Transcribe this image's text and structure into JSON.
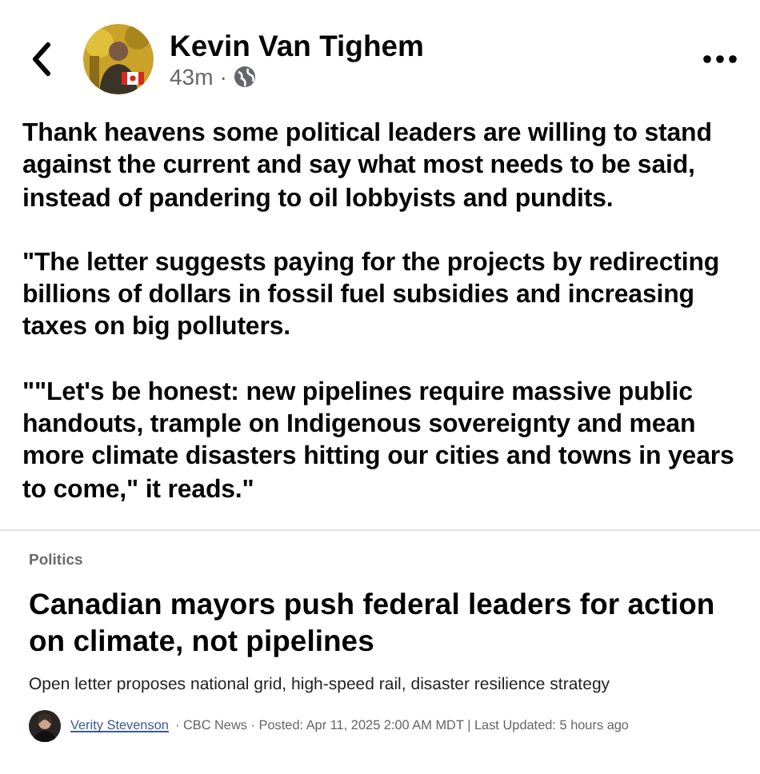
{
  "post": {
    "author": "Kevin Van Tighem",
    "time": "43m",
    "separator": "·",
    "paragraphs": [
      "Thank heavens some political leaders are willing to stand against the current and say what most needs to be said, instead of pandering to oil lobbyists and pundits.",
      "\"The letter suggests paying for the projects by redirecting billions of dollars in fossil fuel subsidies and increasing taxes on big polluters.",
      "\"\"Let's be honest: new pipelines require massive public handouts, trample on Indigenous sovereignty and mean more climate disasters hitting our cities and towns in years to come,\" it reads.\""
    ]
  },
  "article": {
    "section": "Politics",
    "headline": "Canadian mayors push federal leaders for action on climate, not pipelines",
    "summary": "Open letter proposes national grid, high-speed rail, disaster resilience strategy",
    "byline": {
      "author": "Verity Stevenson",
      "details": "· CBC News · Posted: Apr 11, 2025 2:00 AM MDT | Last Updated: 5 hours ago"
    }
  }
}
